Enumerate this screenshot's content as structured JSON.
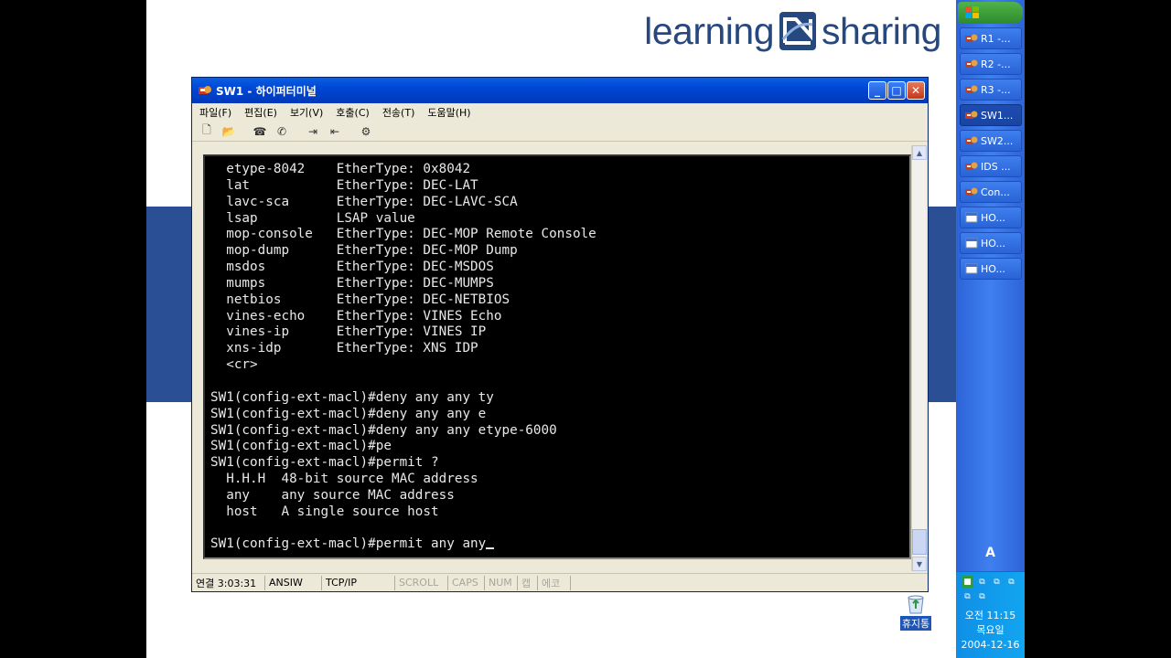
{
  "logo": {
    "left_word": "learning",
    "right_word": "sharing"
  },
  "window": {
    "title": "SW1 - 하이퍼터미널",
    "controls": {
      "minimize": "_",
      "maximize": "□",
      "close": "✕"
    }
  },
  "menu": [
    "파일(F)",
    "편집(E)",
    "보기(V)",
    "호출(C)",
    "전송(T)",
    "도움말(H)"
  ],
  "toolbar_icons": [
    "new-icon",
    "open-icon",
    "disconnect-icon",
    "call-icon",
    "send-icon",
    "receive-icon",
    "properties-icon"
  ],
  "terminal": {
    "lines": [
      "  etype-8042    EtherType: 0x8042",
      "  lat           EtherType: DEC-LAT",
      "  lavc-sca      EtherType: DEC-LAVC-SCA",
      "  lsap          LSAP value",
      "  mop-console   EtherType: DEC-MOP Remote Console",
      "  mop-dump      EtherType: DEC-MOP Dump",
      "  msdos         EtherType: DEC-MSDOS",
      "  mumps         EtherType: DEC-MUMPS",
      "  netbios       EtherType: DEC-NETBIOS",
      "  vines-echo    EtherType: VINES Echo",
      "  vines-ip      EtherType: VINES IP",
      "  xns-idp       EtherType: XNS IDP",
      "  <cr>",
      "",
      "SW1(config-ext-macl)#deny any any ty",
      "SW1(config-ext-macl)#deny any any e",
      "SW1(config-ext-macl)#deny any any etype-6000",
      "SW1(config-ext-macl)#pe",
      "SW1(config-ext-macl)#permit ?",
      "  H.H.H  48-bit source MAC address",
      "  any    any source MAC address",
      "  host   A single source host",
      "",
      "SW1(config-ext-macl)#permit any any"
    ]
  },
  "statusbar": {
    "connection": "연결 3:03:31",
    "emulation": "ANSIW",
    "port": "TCP/IP",
    "scroll": "SCROLL",
    "caps": "CAPS",
    "num": "NUM",
    "capture": "캡",
    "echo": "에코"
  },
  "taskbar": {
    "items": [
      {
        "label": "R1 -...",
        "icon": "terminal-app-icon",
        "active": false
      },
      {
        "label": "R2 -...",
        "icon": "terminal-app-icon",
        "active": false
      },
      {
        "label": "R3 -...",
        "icon": "terminal-app-icon",
        "active": false
      },
      {
        "label": "SW1...",
        "icon": "terminal-app-icon",
        "active": true
      },
      {
        "label": "SW2...",
        "icon": "terminal-app-icon",
        "active": false
      },
      {
        "label": "IDS ...",
        "icon": "terminal-app-icon",
        "active": false
      },
      {
        "label": "Con...",
        "icon": "terminal-app-icon",
        "active": false
      },
      {
        "label": "HO...",
        "icon": "window-app-icon",
        "active": false
      },
      {
        "label": "HO...",
        "icon": "window-app-icon",
        "active": false
      },
      {
        "label": "HO...",
        "icon": "window-app-icon",
        "active": false
      }
    ],
    "language": "A",
    "clock": {
      "time": "오전 11:15",
      "day": "목요일",
      "date": "2004-12-16"
    }
  },
  "desktop": {
    "recycle_bin_label": "휴지통"
  },
  "colors": {
    "band": "#2b4f95",
    "titlebar": "#0047d6",
    "taskbar": "#3f7ff0",
    "terminal_bg": "#000000",
    "terminal_fg": "#e8e8e8"
  }
}
